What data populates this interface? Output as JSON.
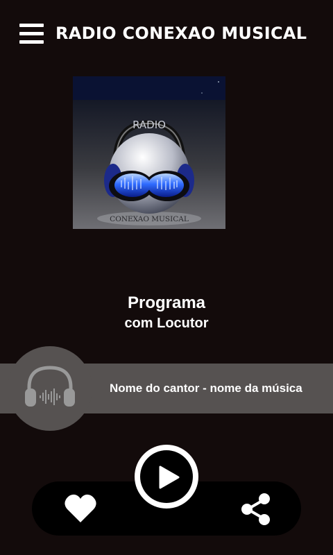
{
  "app_bar": {
    "title": "RADIO CONEXAO MUSICAL",
    "menu_icon": "hamburger-menu-icon"
  },
  "cover": {
    "logo_top_text": "RADIO",
    "logo_bottom_text": "CONEXAO MUSICAL"
  },
  "program": {
    "title": "Programa",
    "host": "com Locutor"
  },
  "now_playing": {
    "text": "Nome do cantor - nome da música",
    "icon": "headphones-icon"
  },
  "controls": {
    "play_icon": "play-icon",
    "favorite_icon": "heart-icon",
    "share_icon": "share-icon"
  },
  "colors": {
    "background": "#130b0b",
    "bar": "#565251",
    "control_bar": "#000000",
    "accent_blue": "#3a6cff"
  }
}
